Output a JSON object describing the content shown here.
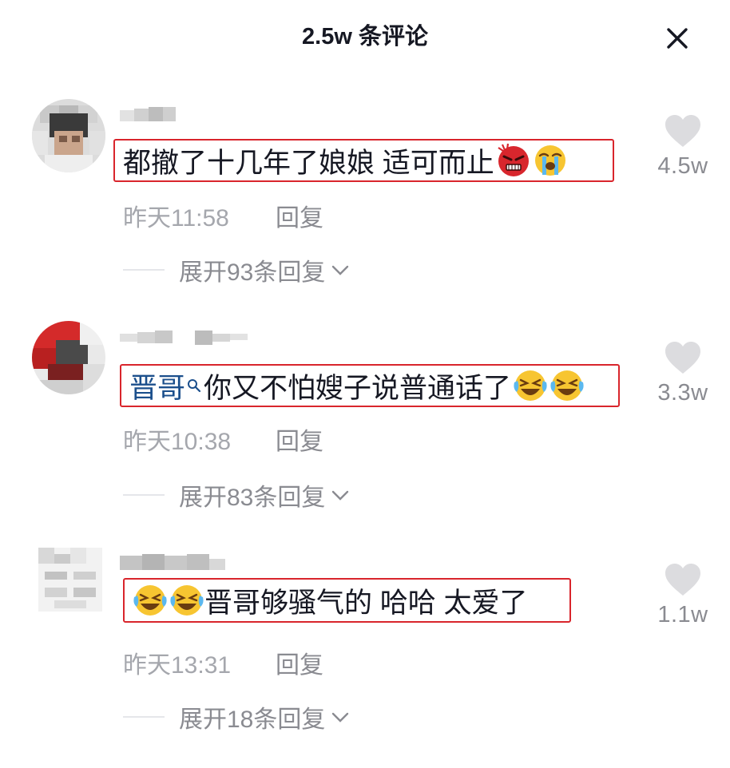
{
  "header": {
    "title": "2.5w 条评论"
  },
  "comments": [
    {
      "segments_before": "",
      "mention": "",
      "text": "都撤了十几年了娘娘 适可而止",
      "emojis_after": [
        "angry-emoji",
        "crying-emoji"
      ],
      "emojis_before": [],
      "time": "昨天11:58",
      "reply_label": "回复",
      "expand_label": "展开93条回复",
      "likes": "4.5w"
    },
    {
      "mention": "晋哥",
      "text": "你又不怕嫂子说普通话了",
      "emojis_after": [
        "laugh-cry-emoji",
        "laugh-cry-emoji"
      ],
      "emojis_before": [],
      "time": "昨天10:38",
      "reply_label": "回复",
      "expand_label": "展开83条回复",
      "likes": "3.3w"
    },
    {
      "mention": "",
      "text": "晋哥够骚气的 哈哈 太爱了",
      "emojis_before": [
        "laugh-cry-emoji",
        "laugh-cry-emoji"
      ],
      "emojis_after": [],
      "time": "昨天13:31",
      "reply_label": "回复",
      "expand_label": "展开18条回复",
      "likes": "1.1w"
    }
  ],
  "colors": {
    "highlight_border": "#d9252c",
    "mention": "#1b4f8c",
    "muted": "#8a8b91"
  }
}
